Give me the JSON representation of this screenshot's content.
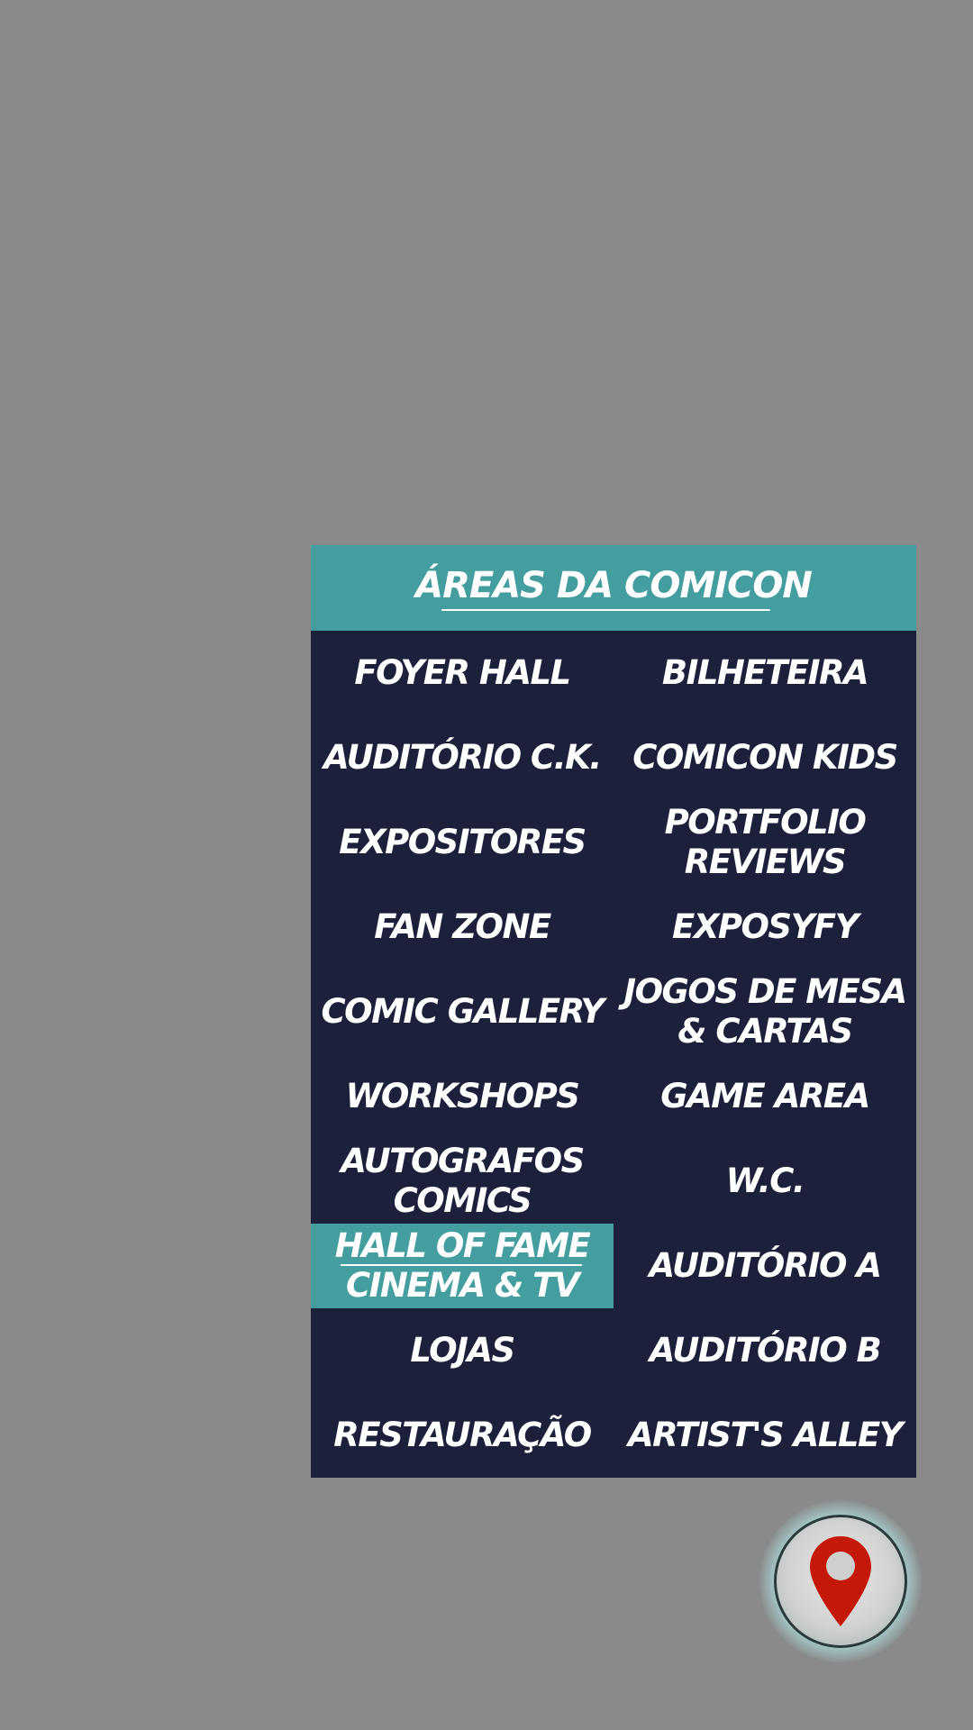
{
  "panel": {
    "title": "ÁREAS DA COMICON"
  },
  "areas": [
    {
      "label": "FOYER HALL",
      "active": false
    },
    {
      "label": "BILHETEIRA",
      "active": false
    },
    {
      "label": "AUDITÓRIO C.K.",
      "active": false
    },
    {
      "label": "COMICON KIDS",
      "active": false
    },
    {
      "label": "EXPOSITORES",
      "active": false
    },
    {
      "label": "PORTFOLIO\nREVIEWS",
      "active": false
    },
    {
      "label": "FAN ZONE",
      "active": false
    },
    {
      "label": "EXPOSYFY",
      "active": false
    },
    {
      "label": "COMIC GALLERY",
      "active": false
    },
    {
      "label": "JOGOS DE MESA\n& CARTAS",
      "active": false
    },
    {
      "label": "WORKSHOPS",
      "active": false
    },
    {
      "label": "GAME AREA",
      "active": false
    },
    {
      "label": "AUTOGRAFOS\nCOMICS",
      "active": false
    },
    {
      "label": "W.C.",
      "active": false
    },
    {
      "label": "HALL OF FAME\nCINEMA & TV",
      "active": true
    },
    {
      "label": "AUDITÓRIO A",
      "active": false
    },
    {
      "label": "LOJAS",
      "active": false
    },
    {
      "label": "AUDITÓRIO B",
      "active": false
    },
    {
      "label": "RESTAURAÇÃO",
      "active": false
    },
    {
      "label": "ARTIST'S ALLEY",
      "active": false
    }
  ],
  "map_button": {
    "icon": "map-pin-icon"
  },
  "colors": {
    "background": "#8a8a8a",
    "panel": "#1d203a",
    "accent": "#449e9f",
    "pin": "#c41808"
  }
}
